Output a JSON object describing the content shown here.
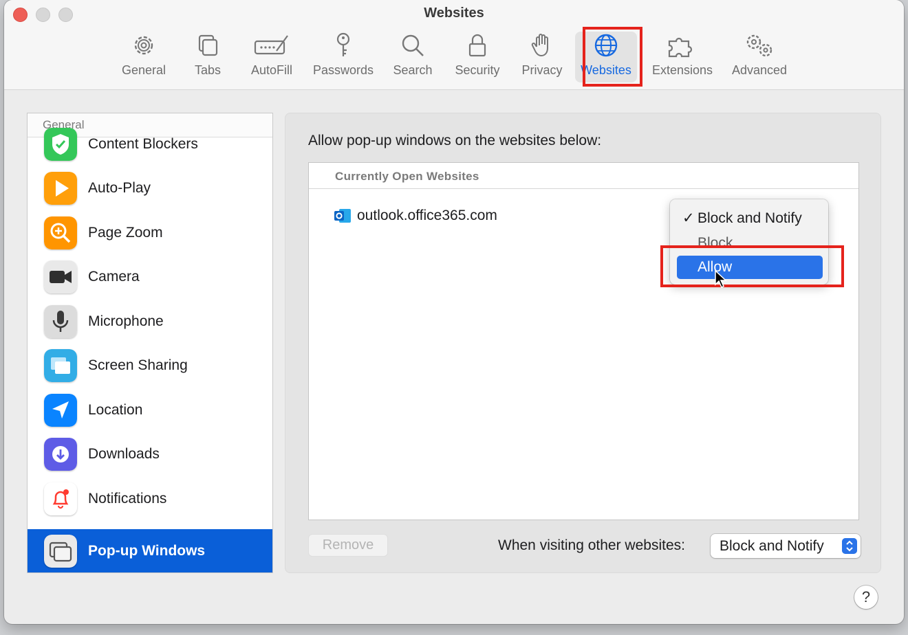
{
  "window": {
    "title": "Websites"
  },
  "toolbar": {
    "items": [
      {
        "label": "General",
        "icon": "gear-icon"
      },
      {
        "label": "Tabs",
        "icon": "tabs-icon"
      },
      {
        "label": "AutoFill",
        "icon": "autofill-icon"
      },
      {
        "label": "Passwords",
        "icon": "key-icon"
      },
      {
        "label": "Search",
        "icon": "search-icon"
      },
      {
        "label": "Security",
        "icon": "lock-icon"
      },
      {
        "label": "Privacy",
        "icon": "hand-icon"
      },
      {
        "label": "Websites",
        "icon": "globe-icon",
        "selected": true
      },
      {
        "label": "Extensions",
        "icon": "puzzle-icon"
      },
      {
        "label": "Advanced",
        "icon": "gears-icon"
      }
    ]
  },
  "sidebar": {
    "header": "General",
    "items": [
      {
        "label": "Content Blockers",
        "icon": "shield-check-icon",
        "color": "#34c759"
      },
      {
        "label": "Auto-Play",
        "icon": "play-icon",
        "color": "#ff9f0a"
      },
      {
        "label": "Page Zoom",
        "icon": "zoom-icon",
        "color": "#ff9500"
      },
      {
        "label": "Camera",
        "icon": "camera-icon",
        "color": "#4a4a4a"
      },
      {
        "label": "Microphone",
        "icon": "microphone-icon",
        "color": "#8e8e93"
      },
      {
        "label": "Screen Sharing",
        "icon": "screen-sharing-icon",
        "color": "#32ade6"
      },
      {
        "label": "Location",
        "icon": "location-arrow-icon",
        "color": "#0a84ff"
      },
      {
        "label": "Downloads",
        "icon": "download-icon",
        "color": "#5e5ce6"
      },
      {
        "label": "Notifications",
        "icon": "bell-icon",
        "color": "#ff3b30"
      },
      {
        "label": "Pop-up Windows",
        "icon": "popup-windows-icon",
        "active": true
      }
    ]
  },
  "main": {
    "caption": "Allow pop-up windows on the websites below:",
    "table_header": "Currently Open Websites",
    "sites": [
      {
        "domain": "outlook.office365.com",
        "icon": "outlook-icon"
      }
    ],
    "menu": {
      "options": [
        "Block and Notify",
        "Block",
        "Allow"
      ],
      "checked": "Block and Notify",
      "highlighted": "Allow",
      "check_mark": "✓"
    },
    "remove_label": "Remove",
    "other_label": "When visiting other websites:",
    "other_value": "Block and Notify"
  },
  "help_label": "?",
  "colors": {
    "accent": "#0a5fd8",
    "highlight_box": "#e5231c",
    "menu_hover": "#2a73e8"
  }
}
